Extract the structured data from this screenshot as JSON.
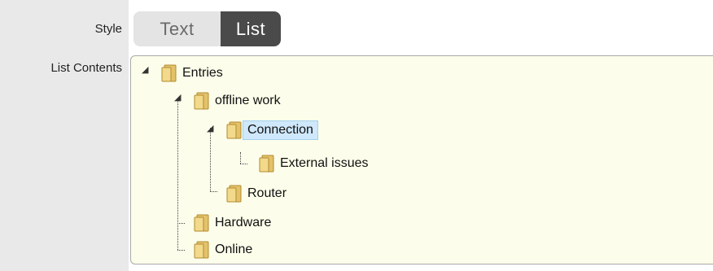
{
  "form": {
    "style_label": "Style",
    "list_contents_label": "List Contents"
  },
  "style_toggle": {
    "options": [
      "Text",
      "List"
    ],
    "selected": "List"
  },
  "tree": {
    "entries": "Entries",
    "offline_work": "offline work",
    "connection": "Connection",
    "external_issues": "External issues",
    "router": "Router",
    "hardware": "Hardware",
    "online": "Online",
    "selected_node": "Connection"
  },
  "colors": {
    "tree_background": "#fcfdea",
    "selected_highlight": "#cfe8fb",
    "toggle_active": "#4a4a4a",
    "toggle_inactive": "#e4e4e4",
    "label_column": "#e9e9e9"
  },
  "icons": {
    "node": "folder-icon",
    "expander": "expand-arrow-icon"
  }
}
